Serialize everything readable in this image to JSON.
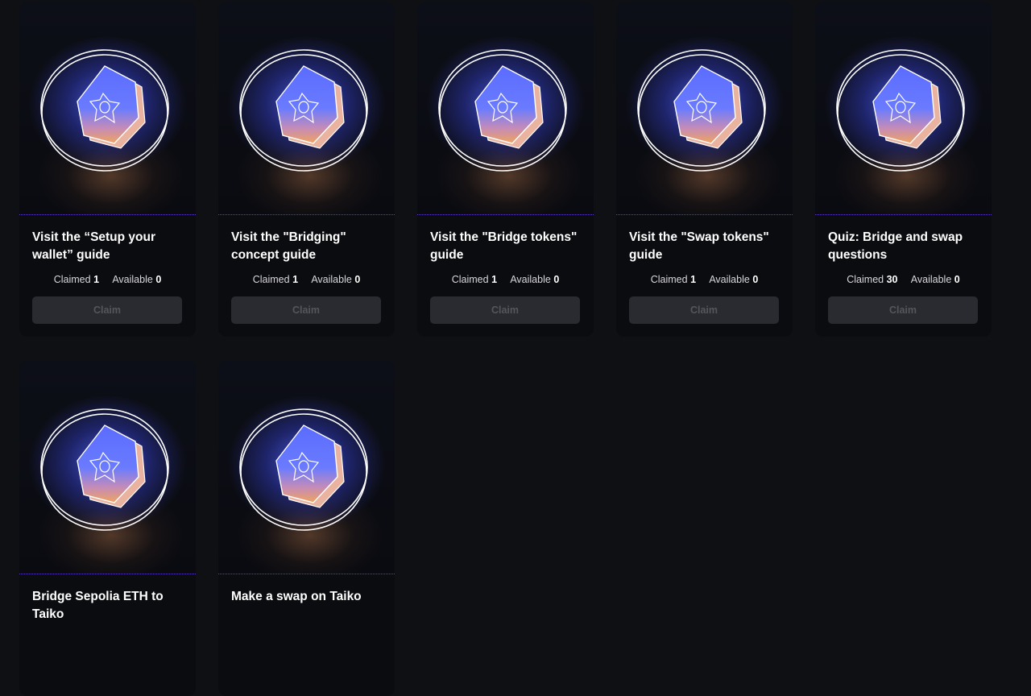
{
  "cards": [
    {
      "title": "Visit the “Setup your wallet” guide",
      "claimed_label": "Claimed",
      "claimed": "1",
      "available_label": "Available",
      "available": "0",
      "button": "Claim"
    },
    {
      "title": "Visit the \"Bridging\" concept guide",
      "claimed_label": "Claimed",
      "claimed": "1",
      "available_label": "Available",
      "available": "0",
      "button": "Claim"
    },
    {
      "title": "Visit the \"Bridge tokens\" guide",
      "claimed_label": "Claimed",
      "claimed": "1",
      "available_label": "Available",
      "available": "0",
      "button": "Claim"
    },
    {
      "title": "Visit the \"Swap tokens\" guide",
      "claimed_label": "Claimed",
      "claimed": "1",
      "available_label": "Available",
      "available": "0",
      "button": "Claim"
    },
    {
      "title": "Quiz: Bridge and swap questions",
      "claimed_label": "Claimed",
      "claimed": "30",
      "available_label": "Available",
      "available": "0",
      "button": "Claim"
    },
    {
      "title": "Bridge Sepolia ETH to Taiko"
    },
    {
      "title": "Make a swap on Taiko"
    }
  ],
  "icons": {
    "badge": "hexagon-badge-icon"
  },
  "colors": {
    "background": "#0f1014",
    "card": "#0b0c0f",
    "button_disabled": "#2a2b30"
  }
}
